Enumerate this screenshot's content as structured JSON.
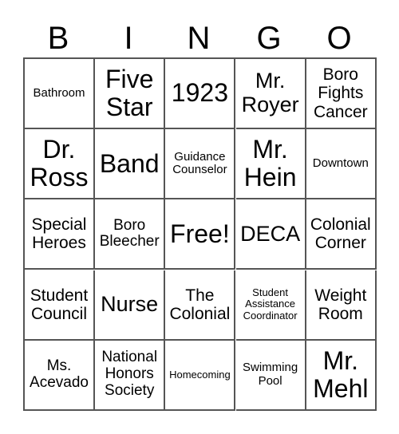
{
  "header": {
    "letters": [
      "B",
      "I",
      "N",
      "G",
      "O"
    ]
  },
  "cells": [
    {
      "text": "Bathroom",
      "size": "s"
    },
    {
      "text": "Five Star",
      "size": "xl"
    },
    {
      "text": "1923",
      "size": "xl"
    },
    {
      "text": "Mr. Royer",
      "size": "l"
    },
    {
      "text": "Boro Fights Cancer",
      "size": "m"
    },
    {
      "text": "Dr. Ross",
      "size": "xl"
    },
    {
      "text": "Band",
      "size": "xl"
    },
    {
      "text": "Guidance Counselor",
      "size": "s"
    },
    {
      "text": "Mr. Hein",
      "size": "xl"
    },
    {
      "text": "Downtown",
      "size": "s"
    },
    {
      "text": "Special Heroes",
      "size": "m"
    },
    {
      "text": "Boro Bleecher",
      "size": "ms"
    },
    {
      "text": "Free!",
      "size": "xl"
    },
    {
      "text": "DECA",
      "size": "l"
    },
    {
      "text": "Colonial Corner",
      "size": "m"
    },
    {
      "text": "Student Council",
      "size": "m"
    },
    {
      "text": "Nurse",
      "size": "l"
    },
    {
      "text": "The Colonial",
      "size": "m"
    },
    {
      "text": "Student Assistance Coordinator",
      "size": "xs"
    },
    {
      "text": "Weight Room",
      "size": "m"
    },
    {
      "text": "Ms. Acevado",
      "size": "ms"
    },
    {
      "text": "National Honors Society",
      "size": "ms"
    },
    {
      "text": "Homecoming",
      "size": "xs"
    },
    {
      "text": "Swimming Pool",
      "size": "s"
    },
    {
      "text": "Mr. Mehl",
      "size": "xl"
    }
  ]
}
